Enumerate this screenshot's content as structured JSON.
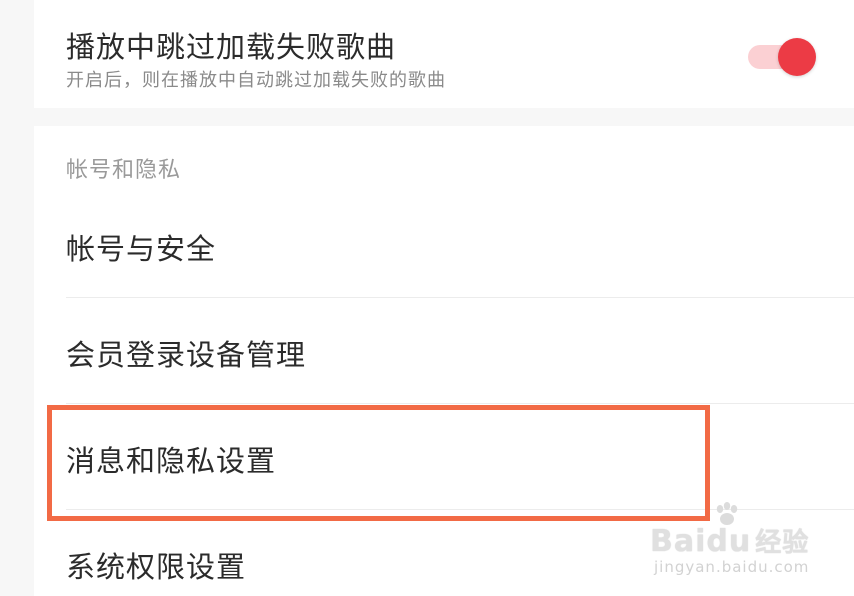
{
  "settings": {
    "skip_failed": {
      "title": "播放中跳过加载失败歌曲",
      "subtitle": "开启后，则在播放中自动跳过加载失败的歌曲",
      "toggle_on": true
    },
    "section_header": "帐号和隐私",
    "items": [
      {
        "label": "帐号与安全"
      },
      {
        "label": "会员登录设备管理"
      },
      {
        "label": "消息和隐私设置"
      },
      {
        "label": "系统权限设置"
      }
    ]
  },
  "colors": {
    "accent": "#ec3b45",
    "toggle_track": "#fbd0d3",
    "highlight": "#f26a45"
  },
  "watermark": {
    "brand": "Baidu",
    "suffix": "经验",
    "url": "jingyan.baidu.com"
  }
}
